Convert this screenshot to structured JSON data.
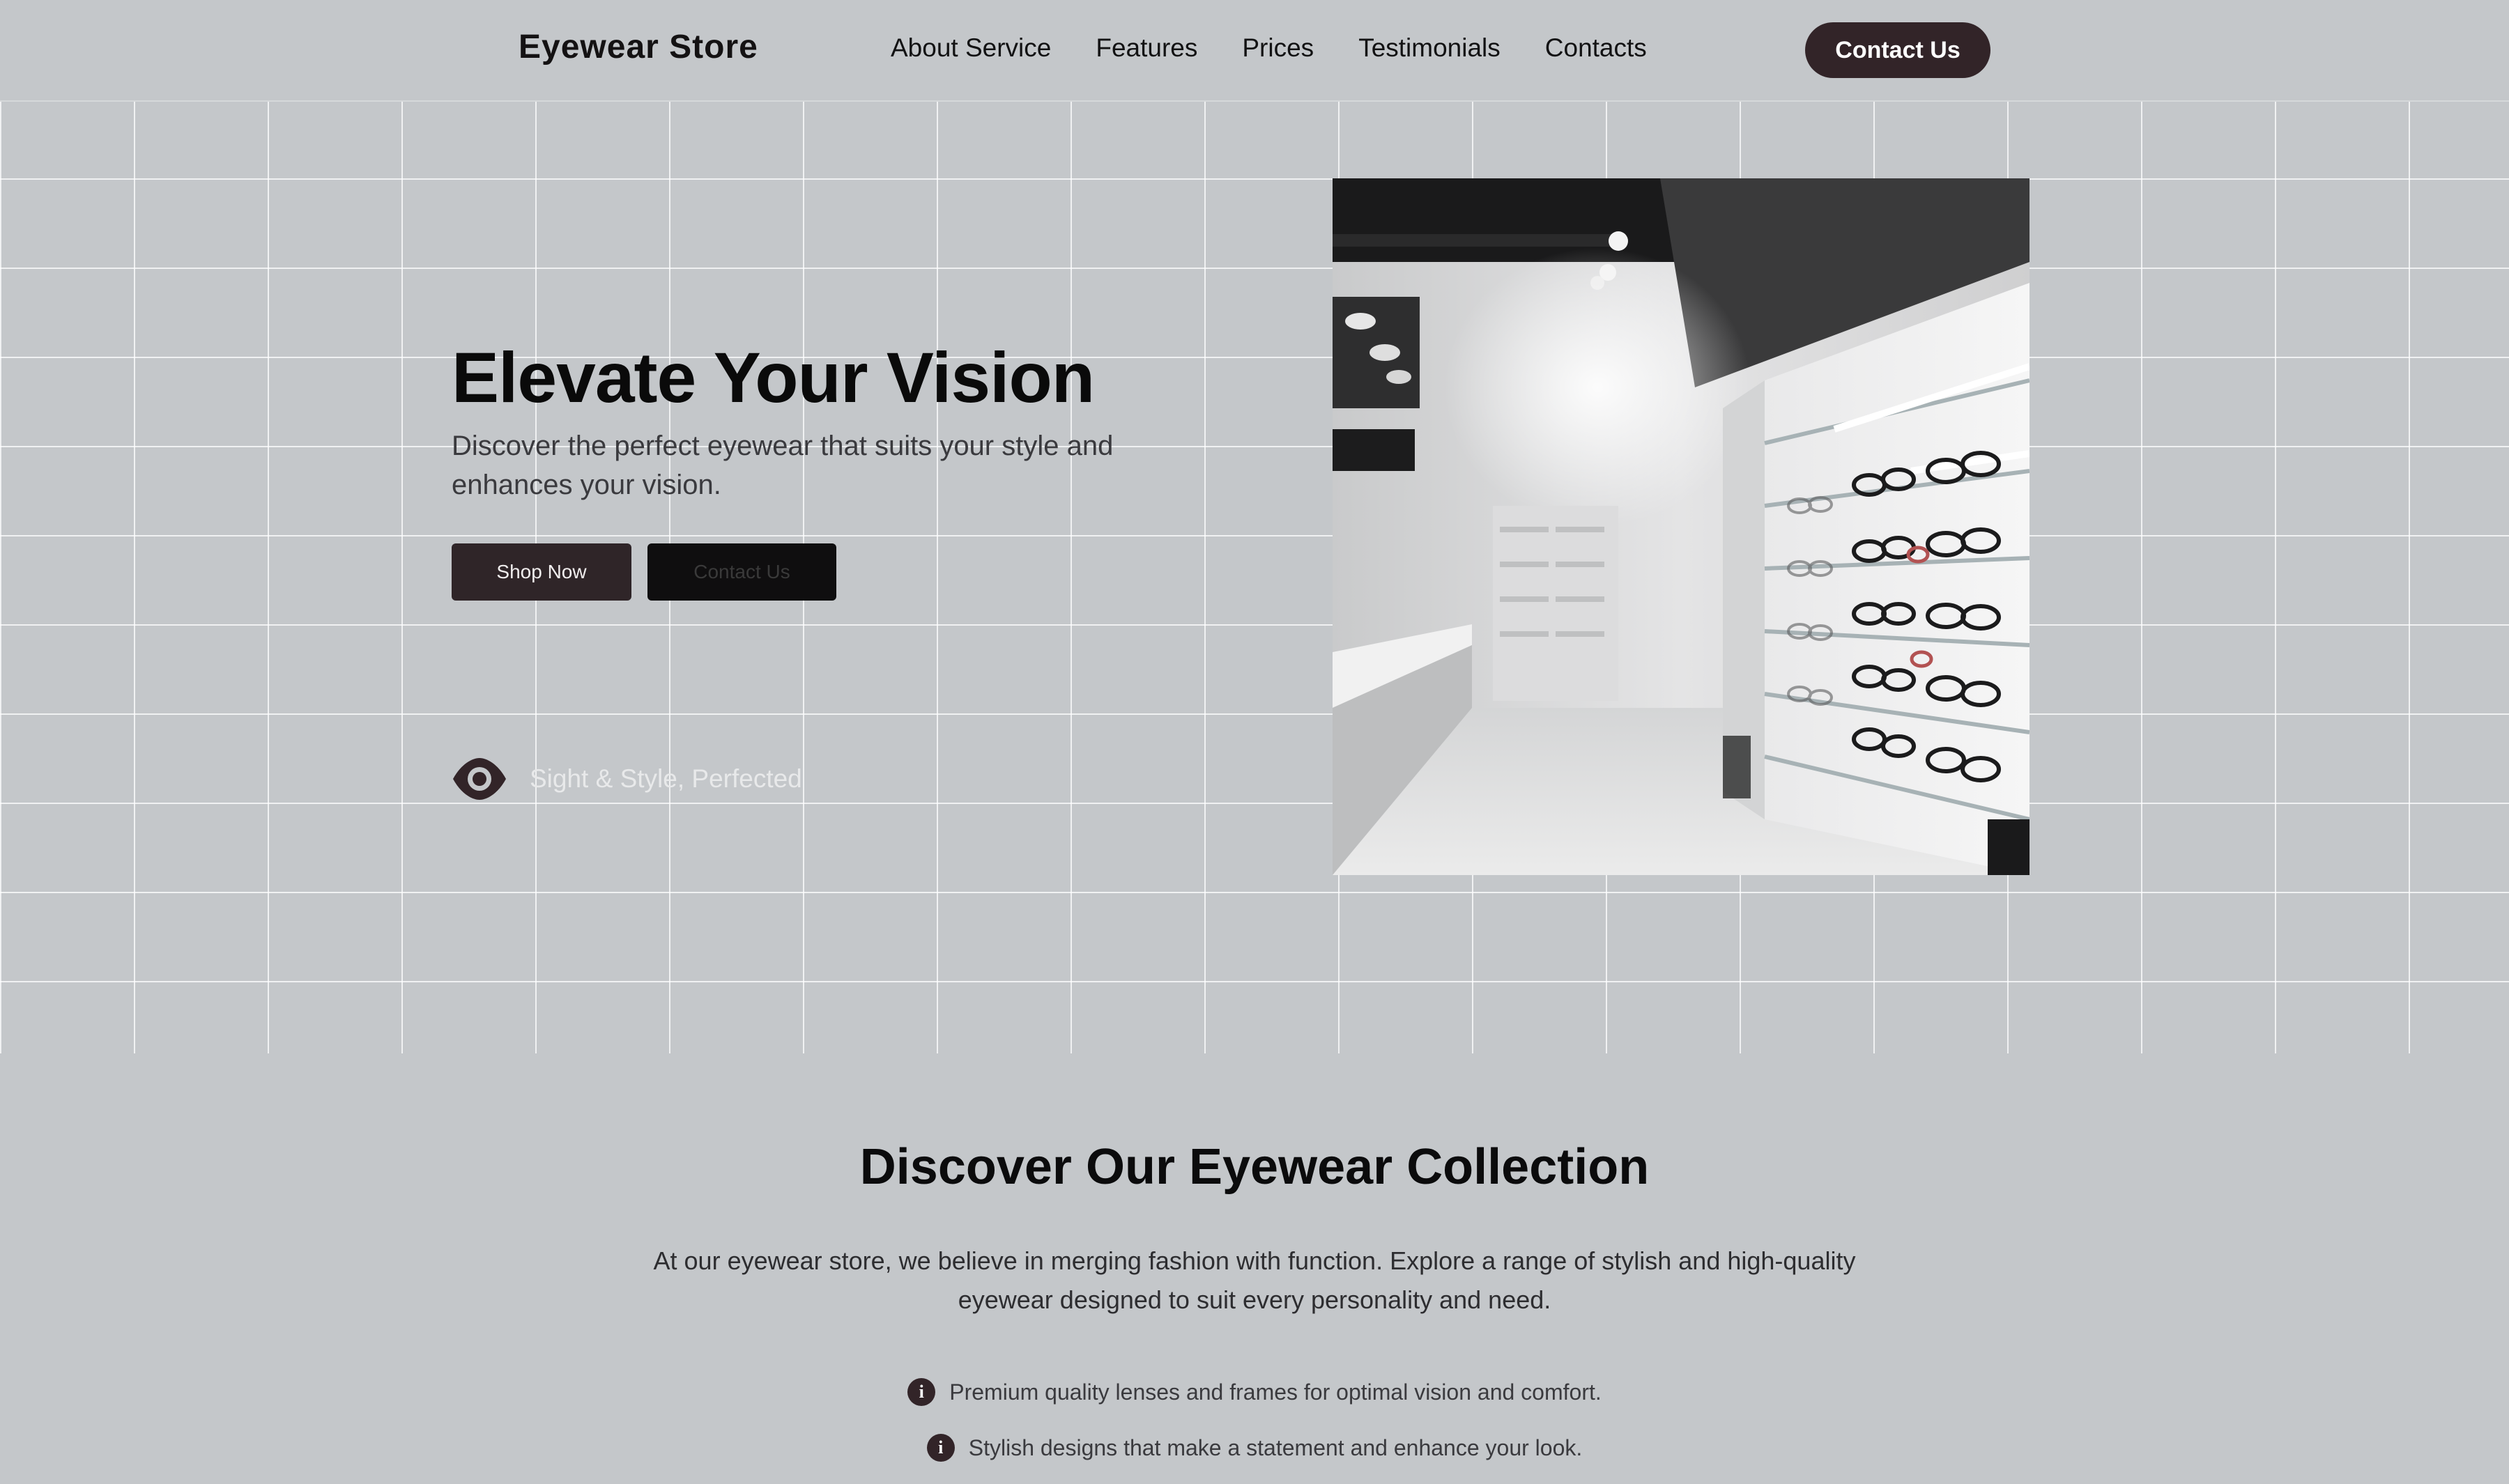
{
  "header": {
    "brand": "Eyewear Store",
    "nav": [
      "About Service",
      "Features",
      "Prices",
      "Testimonials",
      "Contacts"
    ],
    "cta_label": "Contact Us"
  },
  "hero": {
    "title": "Elevate Your Vision",
    "subtitle": "Discover the perfect eyewear that suits your style and enhances your vision.",
    "primary_button": "Shop Now",
    "secondary_button": "Contact Us",
    "tagline": "Sight & Style, Perfected",
    "tagline_icon": "eye-icon",
    "image_subject": "eyewear-store-shelves"
  },
  "collection": {
    "title": "Discover Our Eyewear Collection",
    "description": "At our eyewear store, we believe in merging fashion with function. Explore a range of stylish and high-quality eyewear designed to suit every personality and need.",
    "features": [
      "Premium quality lenses and frames for optimal vision and comfort.",
      "Stylish designs that make a statement and enhance your look.",
      ""
    ],
    "feature_icon": "info-icon"
  },
  "colors": {
    "background": "#c4c7ca",
    "accent": "#322428",
    "dark_button": "#0f0e0f",
    "grid_line": "#ffffff"
  }
}
